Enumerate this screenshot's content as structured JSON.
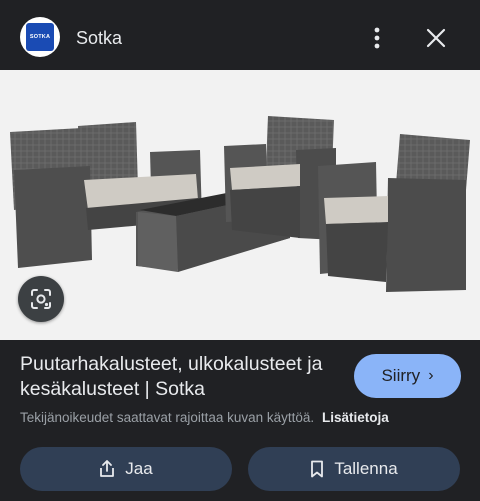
{
  "header": {
    "logo_text": "SOTKA",
    "site_name": "Sotka",
    "more_icon": "more-vert-icon",
    "close_icon": "close-icon"
  },
  "image": {
    "lens_icon": "lens-icon"
  },
  "result": {
    "title": "Puutarhakalusteet, ulkokalusteet ja kesäkalusteet | Sotka",
    "visit_label": "Siirry",
    "copyright_text": "Tekijänoikeudet saattavat rajoittaa kuvan käyttöä.",
    "learn_more": "Lisätietoja"
  },
  "actions": {
    "share_label": "Jaa",
    "save_label": "Tallenna"
  },
  "colors": {
    "background": "#202124",
    "accent": "#8ab4f8",
    "action_bg": "#303f55"
  }
}
